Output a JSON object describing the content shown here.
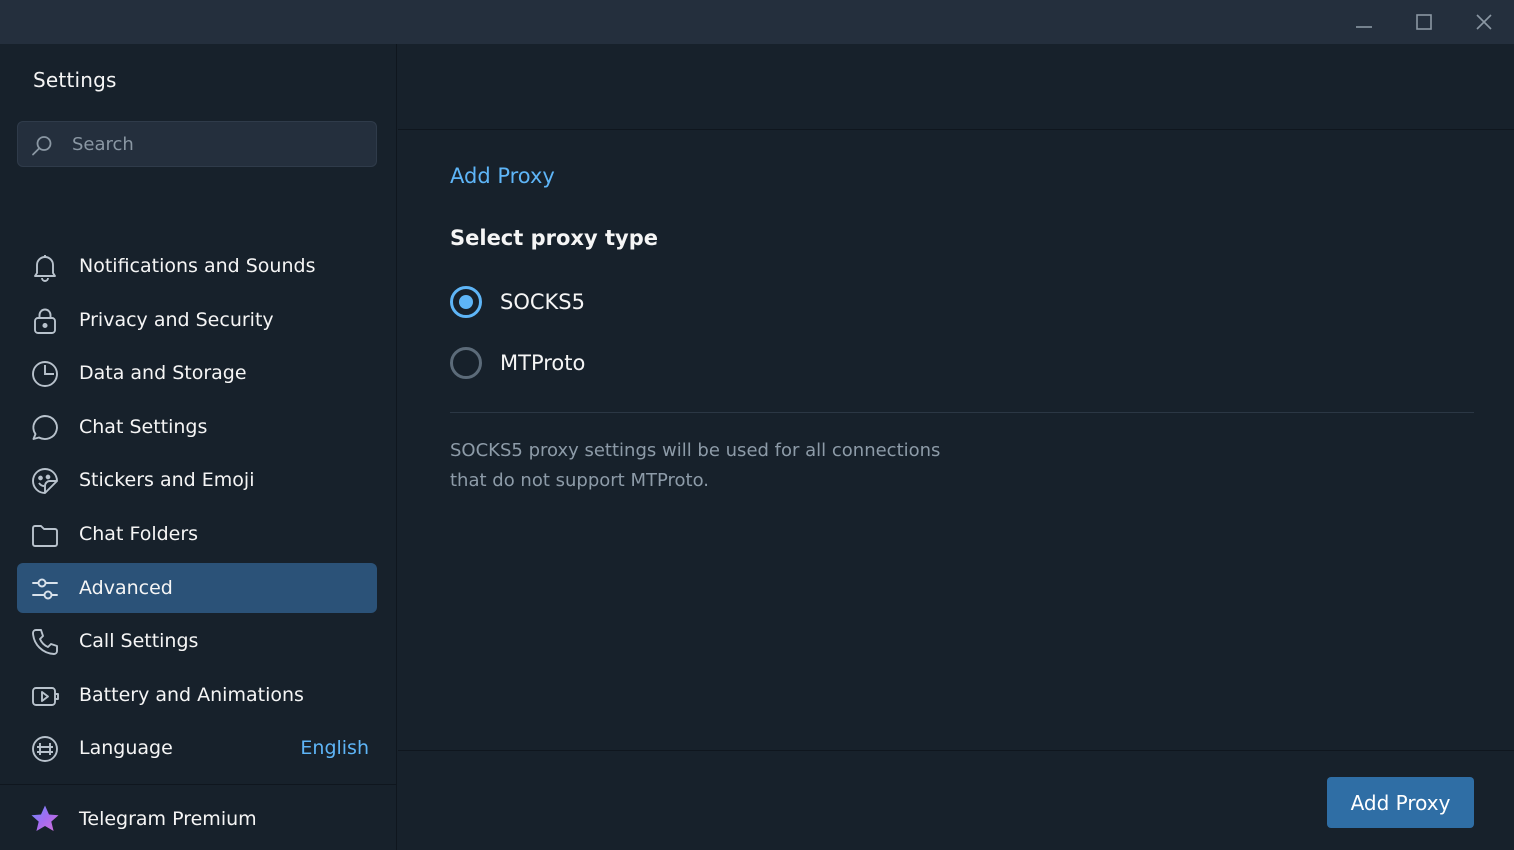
{
  "window": {
    "controls": {
      "minimize_icon": "minimize-icon",
      "maximize_icon": "maximize-icon",
      "close_icon": "close-icon"
    }
  },
  "sidebar": {
    "title": "Settings",
    "search": {
      "placeholder": "Search",
      "value": ""
    },
    "items": [
      {
        "label": "Notifications and Sounds",
        "icon": "bell-icon"
      },
      {
        "label": "Privacy and Security",
        "icon": "lock-icon"
      },
      {
        "label": "Data and Storage",
        "icon": "pie-chart-icon"
      },
      {
        "label": "Chat Settings",
        "icon": "chat-bubble-icon"
      },
      {
        "label": "Stickers and Emoji",
        "icon": "sticker-icon"
      },
      {
        "label": "Chat Folders",
        "icon": "folder-icon"
      },
      {
        "label": "Advanced",
        "icon": "sliders-icon",
        "active": true
      },
      {
        "label": "Call Settings",
        "icon": "phone-icon"
      },
      {
        "label": "Battery and Animations",
        "icon": "play-video-icon"
      },
      {
        "label": "Language",
        "icon": "globe-icon",
        "value": "English"
      }
    ],
    "premium": {
      "label": "Telegram Premium",
      "icon": "star-icon"
    }
  },
  "main": {
    "section_title": "Add Proxy",
    "subtitle": "Select proxy type",
    "proxy_types": [
      {
        "label": "SOCKS5",
        "checked": true
      },
      {
        "label": "MTProto",
        "checked": false
      }
    ],
    "hint_line1": "SOCKS5 proxy settings will be used for all connections",
    "hint_line2": "that do not support MTProto.",
    "primary_button": "Add Proxy"
  },
  "colors": {
    "background": "#17212b",
    "titlebar": "#242f3d",
    "accent": "#5eb5f7",
    "active_item": "#2b5278",
    "button": "#2f6ea5",
    "muted_text": "#8d9ba8"
  }
}
